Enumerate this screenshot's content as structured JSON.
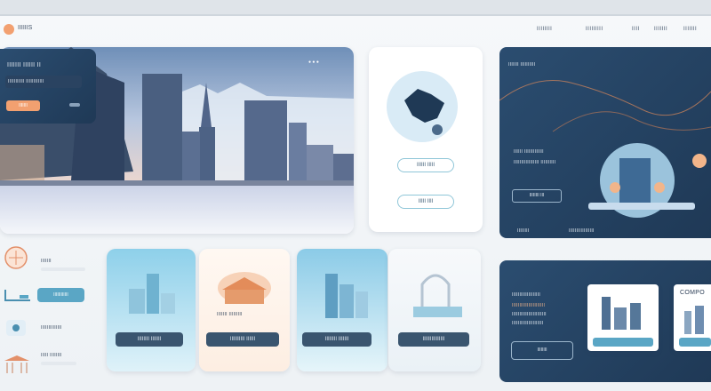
{
  "header": {
    "brand": "IIIIIIS",
    "nav": [
      "IIIIIIII",
      "IIIIIIIII",
      "IIII",
      "IIIIIII",
      "IIIIIII"
    ]
  },
  "hero": {
    "title": "IIIIIII IIIIII II",
    "subtitle": "IIIIIIIIIII IIIIIIIIIIII",
    "cta": "IIIIIII",
    "dots": "● ● ●"
  },
  "globe_card": {
    "label1": "IIIIII IIIII",
    "label2": "IIIII IIII"
  },
  "promo": {
    "heading": "IIIIIII IIIIIIIIII",
    "line1": "IIIIII IIIIIIIIIIIII",
    "line2": "IIIIIIIIIIIIIIIII IIIIIIIIII",
    "btn": "IIIIIIII III",
    "footer1": "IIIIIIII",
    "footer2": "IIIIIIIIIIIIIIIII"
  },
  "side_list": [
    {
      "label": "IIIIIII"
    },
    {
      "label": "IIIIIIIIIIII"
    },
    {
      "label": "IIIIIIIIIIIIII"
    },
    {
      "label": "IIIII IIIIIIII"
    }
  ],
  "tiles": [
    {
      "caption": "",
      "button": "IIIIIIII IIIIIII"
    },
    {
      "caption": "IIIIIII IIIIIIIII",
      "button": "IIIIIIIIII IIIIII"
    },
    {
      "caption": "",
      "button": "IIIIIIII IIIIIII"
    },
    {
      "caption": "",
      "button": "IIIIIIIIIIIIIII"
    }
  ],
  "bottom_panel": {
    "title": "IIIIIIIIIIIIIIIIIII",
    "line1": "IIIIIIIIIIIIIIIIIIIIII",
    "line2": "IIIIIIIIIIIIIIIIIIIIIII",
    "line3": "IIIIIIIIIIIIIIIIIIIII",
    "btn": "IIIIIIII",
    "thumb_label": "COMPO"
  },
  "colors": {
    "accent": "#f2a070",
    "dark": "#274766",
    "teal": "#5aa6c5"
  }
}
